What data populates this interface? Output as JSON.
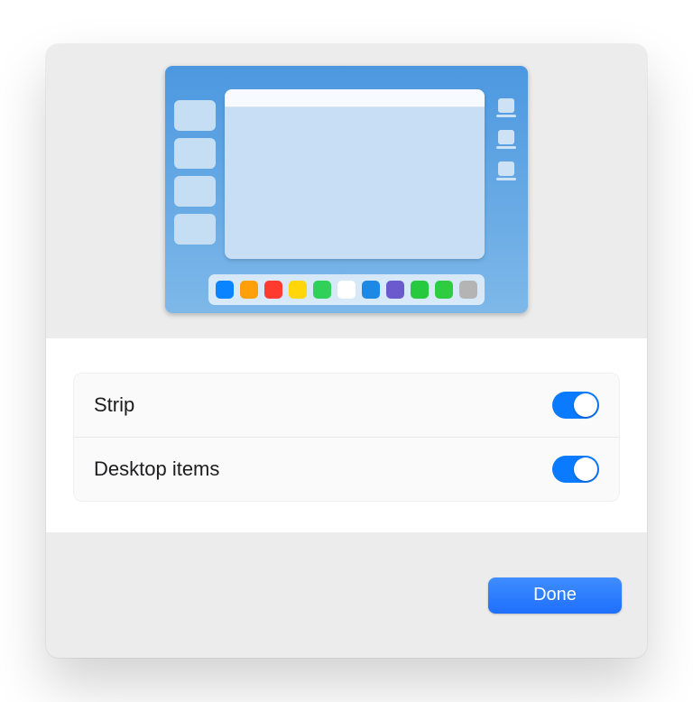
{
  "options": {
    "strip": {
      "label": "Strip",
      "value": true
    },
    "desktop_items": {
      "label": "Desktop items",
      "value": true
    }
  },
  "buttons": {
    "done": "Done"
  },
  "dock_colors": [
    "c-blue",
    "c-orange",
    "c-red",
    "c-yellow",
    "c-green",
    "c-white",
    "c-blue2",
    "c-purple",
    "c-green2",
    "c-green3",
    "c-gray"
  ]
}
